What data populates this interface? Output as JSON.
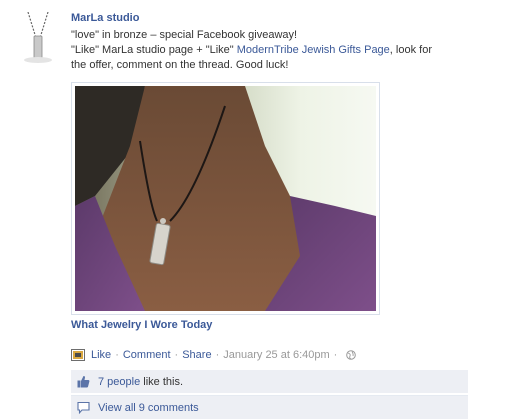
{
  "post": {
    "author": "MarLa studio",
    "line1": "\"love\" in bronze – special Facebook giveaway!",
    "line2_prefix": "\"Like\" MarLa studio page + \"Like\" ",
    "line2_link": "ModernTribe Jewish Gifts Page",
    "line2_suffix": ", look for",
    "line3": "the offer, comment on the thread. Good luck!",
    "caption": "What Jewelry I Wore Today"
  },
  "actions": {
    "like": "Like",
    "comment": "Comment",
    "share": "Share",
    "timestamp": "January 25 at 6:40pm",
    "separator": "·"
  },
  "likes": {
    "people_link": "7 people",
    "suffix": " like this."
  },
  "comments": {
    "view_all": "View all 9 comments"
  },
  "icons": {
    "avatar": "pendant-necklace-thumbnail",
    "app": "app-icon",
    "privacy": "globe-icon",
    "like": "thumbs-up-icon",
    "comment": "comment-bubble-icon"
  },
  "colors": {
    "link": "#3b5998",
    "meta": "#999999",
    "ufi_bg": "#edeff4"
  }
}
